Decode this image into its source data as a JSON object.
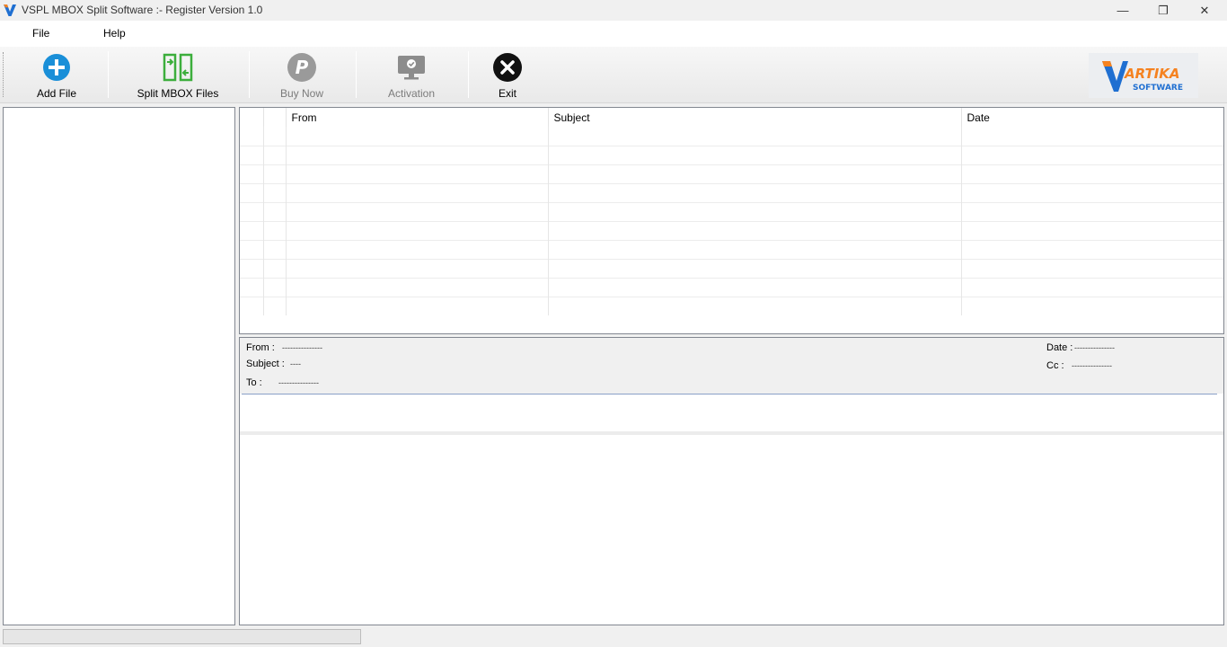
{
  "window": {
    "title": "VSPL MBOX Split Software :- Register Version 1.0",
    "logo_icon": "vspl-v-logo-icon",
    "controls": {
      "minimize": "—",
      "maximize": "❐",
      "close": "✕"
    }
  },
  "menu": {
    "file": "File",
    "help": "Help"
  },
  "toolbar": {
    "add_file": {
      "label": "Add File",
      "icon": "add-circle-icon",
      "color": "#1a8fd8"
    },
    "split": {
      "label": "Split MBOX Files",
      "icon": "split-files-icon",
      "color": "#3cae3c"
    },
    "buy_now": {
      "label": "Buy Now",
      "icon": "paypal-icon",
      "color": "#8c8c8c"
    },
    "activation": {
      "label": "Activation",
      "icon": "monitor-check-icon",
      "color": "#8c8c8c"
    },
    "exit": {
      "label": "Exit",
      "icon": "exit-circle-icon",
      "color": "#111111"
    }
  },
  "brand": {
    "top": "ARTIKA",
    "bottom": "SOFTWARE",
    "accent": "#f58220",
    "primary": "#1f6fd1"
  },
  "mail_list": {
    "columns": [
      "",
      "",
      "From",
      "Subject",
      "Date"
    ],
    "row_count": 10
  },
  "preview": {
    "from_label": "From :",
    "from_value": "---------------",
    "subject_label": "Subject :",
    "subject_value": "----",
    "to_label": "To :",
    "to_value": "---------------",
    "date_label": "Date :",
    "date_value": "---------------",
    "cc_label": "Cc :",
    "cc_value": "---------------"
  },
  "progress": {
    "value": 0
  }
}
